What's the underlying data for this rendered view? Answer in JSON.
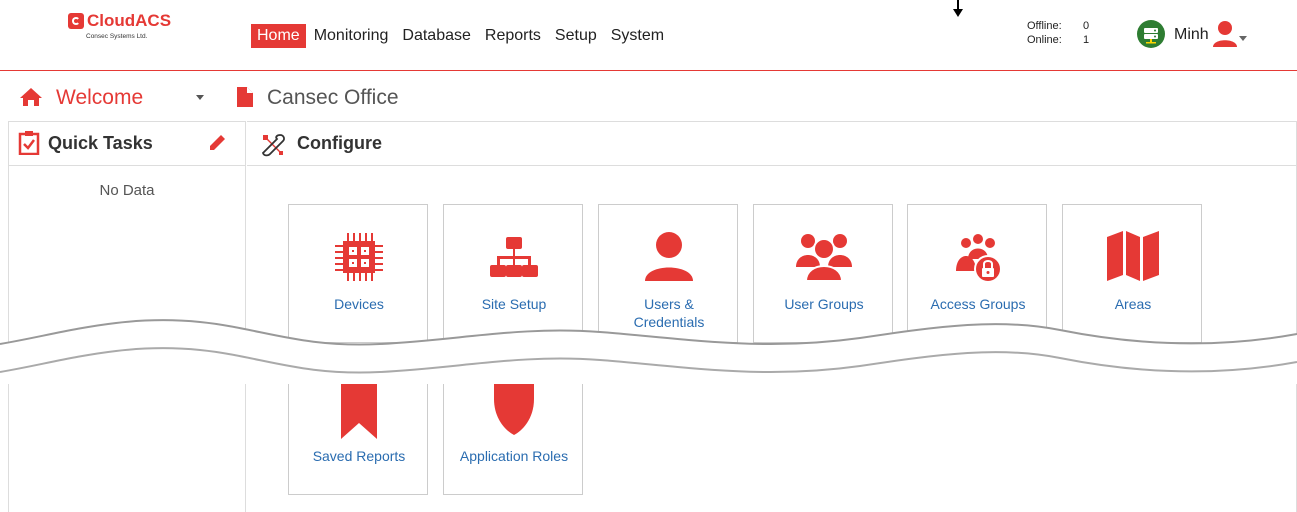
{
  "header": {
    "brand": "CloudACS",
    "brand_sub": "Consec Systems Ltd.",
    "nav": [
      {
        "label": "Home",
        "active": true
      },
      {
        "label": "Monitoring",
        "active": false
      },
      {
        "label": "Database",
        "active": false
      },
      {
        "label": "Reports",
        "active": false
      },
      {
        "label": "Setup",
        "active": false
      },
      {
        "label": "System",
        "active": false
      }
    ],
    "status": {
      "offline_label": "Offline:",
      "offline_count": "0",
      "online_label": "Online:",
      "online_count": "1"
    },
    "username": "Minh"
  },
  "breadcrumb": {
    "welcome": "Welcome",
    "office": "Cansec Office"
  },
  "quick_tasks": {
    "title": "Quick Tasks",
    "empty_text": "No Data"
  },
  "configure": {
    "title": "Configure",
    "tiles": [
      {
        "label": "Devices",
        "icon": "chip-icon"
      },
      {
        "label": "Site Setup",
        "icon": "sitemap-icon"
      },
      {
        "label": "Users & Credentials",
        "icon": "user-icon"
      },
      {
        "label": "User Groups",
        "icon": "users-icon"
      },
      {
        "label": "Access Groups",
        "icon": "access-groups-icon"
      },
      {
        "label": "Areas",
        "icon": "map-icon"
      },
      {
        "label": "Saved Reports",
        "icon": "bookmark-icon"
      },
      {
        "label": "Application Roles",
        "icon": "shield-icon"
      }
    ]
  },
  "colors": {
    "accent": "#e53935",
    "link": "#2a6cb0",
    "online": "#2e7d32"
  }
}
